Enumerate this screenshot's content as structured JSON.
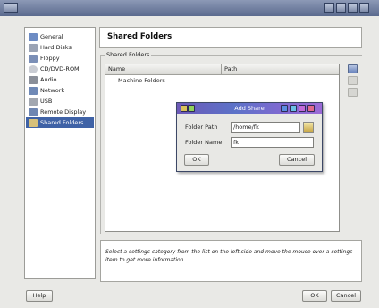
{
  "window": {
    "title": ""
  },
  "sidebar": {
    "items": [
      {
        "label": "General",
        "icon": "general-icon",
        "color": "#6d8cc4"
      },
      {
        "label": "Hard Disks",
        "icon": "hard-disk-icon",
        "color": "#9ba4b5"
      },
      {
        "label": "Floppy",
        "icon": "floppy-icon",
        "color": "#7b8fb7"
      },
      {
        "label": "CD/DVD-ROM",
        "icon": "cd-icon",
        "color": "#c9ccd3"
      },
      {
        "label": "Audio",
        "icon": "audio-icon",
        "color": "#8a8f99"
      },
      {
        "label": "Network",
        "icon": "network-icon",
        "color": "#6f89b6"
      },
      {
        "label": "USB",
        "icon": "usb-icon",
        "color": "#a2a7b0"
      },
      {
        "label": "Remote Display",
        "icon": "remote-display-icon",
        "color": "#6e86b2"
      },
      {
        "label": "Shared Folders",
        "icon": "folder-icon",
        "color": "#d6c07a",
        "selected": true
      }
    ]
  },
  "header": {
    "title": "Shared Folders"
  },
  "shared": {
    "group_label": "Shared Folders",
    "columns": [
      "Name",
      "Path"
    ],
    "rows": [
      "Machine Folders"
    ]
  },
  "dialog": {
    "title": "Add Share",
    "folder_path_label": "Folder Path",
    "folder_path_value": "/home/fk",
    "folder_name_label": "Folder Name",
    "folder_name_value": "fk",
    "ok_label": "OK",
    "cancel_label": "Cancel"
  },
  "info": {
    "text": "Select a settings category from the list on the left side and move the mouse over a settings item to get more information."
  },
  "buttons": {
    "help": "Help",
    "ok": "OK",
    "cancel": "Cancel"
  },
  "colors": {
    "selection": "#3f62a6",
    "titlebar": "#5b6a8e"
  }
}
